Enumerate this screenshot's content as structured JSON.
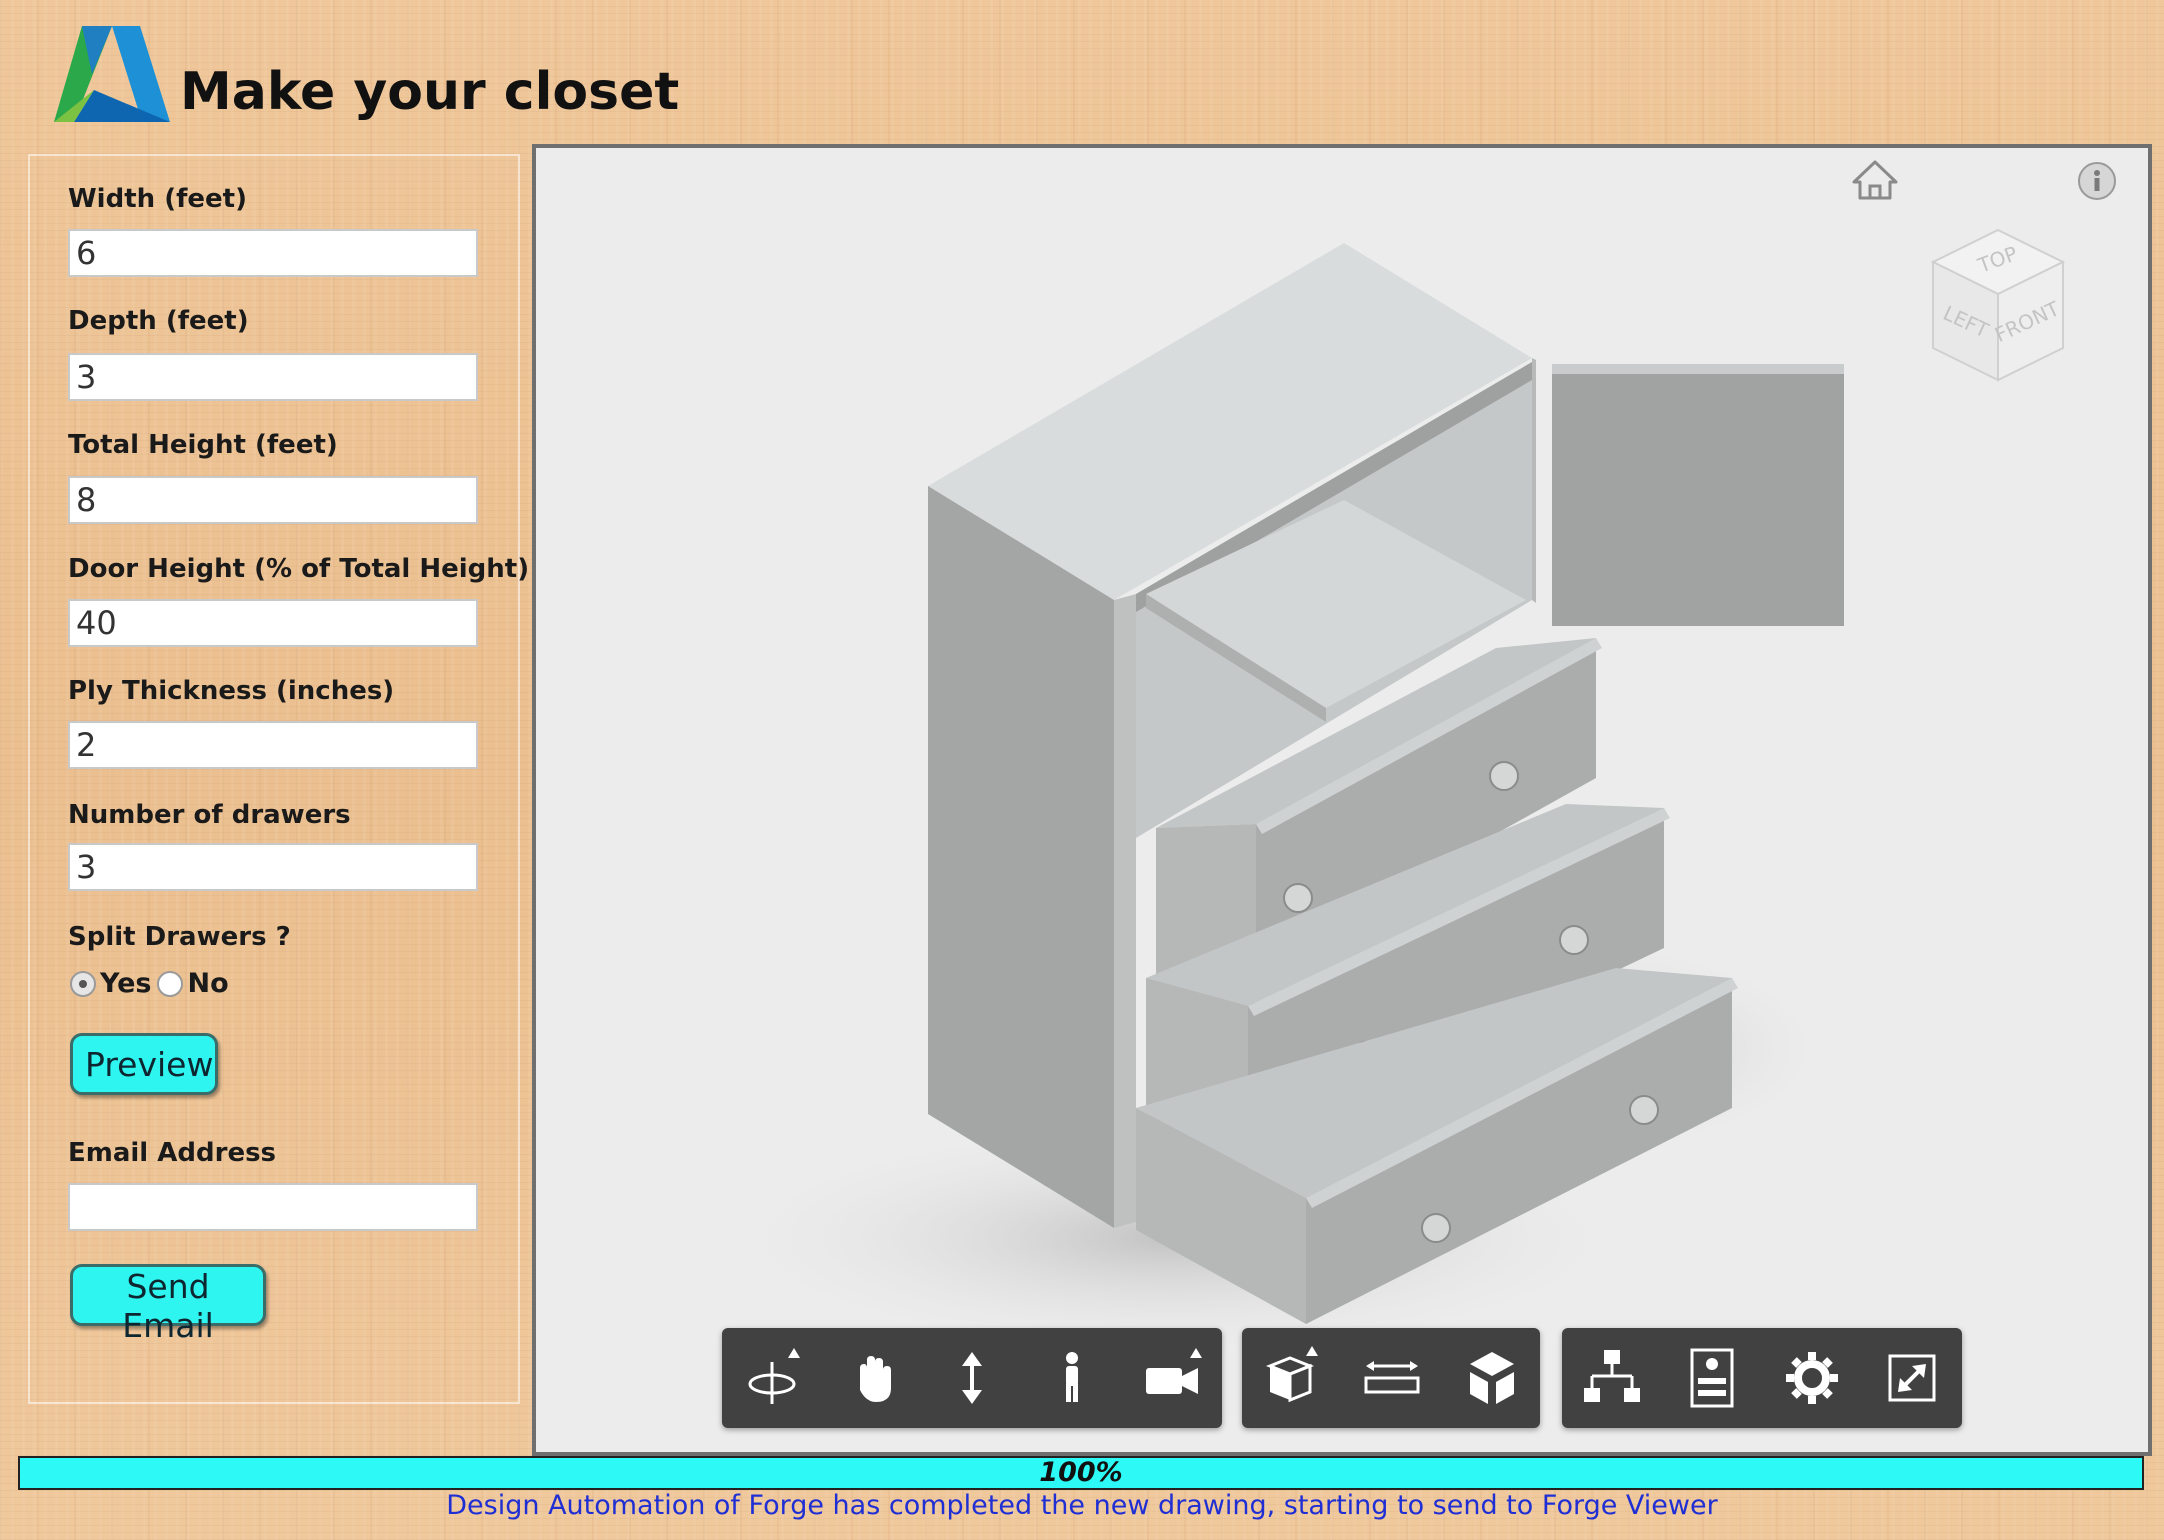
{
  "app": {
    "title": "Make your closet",
    "logo_icon": "autodesk-logo-icon"
  },
  "form": {
    "width": {
      "label": "Width (feet)",
      "value": "6"
    },
    "depth": {
      "label": "Depth (feet)",
      "value": "3"
    },
    "total_height": {
      "label": "Total Height (feet)",
      "value": "8"
    },
    "door_height": {
      "label": "Door Height (% of Total Height)",
      "value": "40"
    },
    "ply_thickness": {
      "label": "Ply Thickness (inches)",
      "value": "2"
    },
    "num_drawers": {
      "label": "Number of drawers",
      "value": "3"
    },
    "split_drawers": {
      "label": "Split Drawers ?",
      "options": [
        "Yes",
        "No"
      ],
      "selected": "Yes"
    },
    "preview_button": "Preview",
    "email": {
      "label": "Email Address",
      "value": ""
    },
    "send_email_button": "Send Email"
  },
  "viewer": {
    "background": "#ececec",
    "viewcube": {
      "top": "TOP",
      "left": "LEFT",
      "front": "FRONT"
    },
    "toolbar": {
      "navigation": [
        "orbit-icon",
        "pan-icon",
        "zoom-icon",
        "first-person-icon",
        "camera-icon"
      ],
      "modeling": [
        "explode-icon",
        "measure-icon",
        "section-cube-icon"
      ],
      "settings": [
        "model-browser-icon",
        "properties-icon",
        "settings-gear-icon",
        "fullscreen-icon"
      ]
    }
  },
  "progress": {
    "percent": 100,
    "label": "100%",
    "color": "#2df9f6"
  },
  "status": {
    "message": "Design Automation of Forge has completed the new drawing, starting to send to Forge Viewer"
  }
}
